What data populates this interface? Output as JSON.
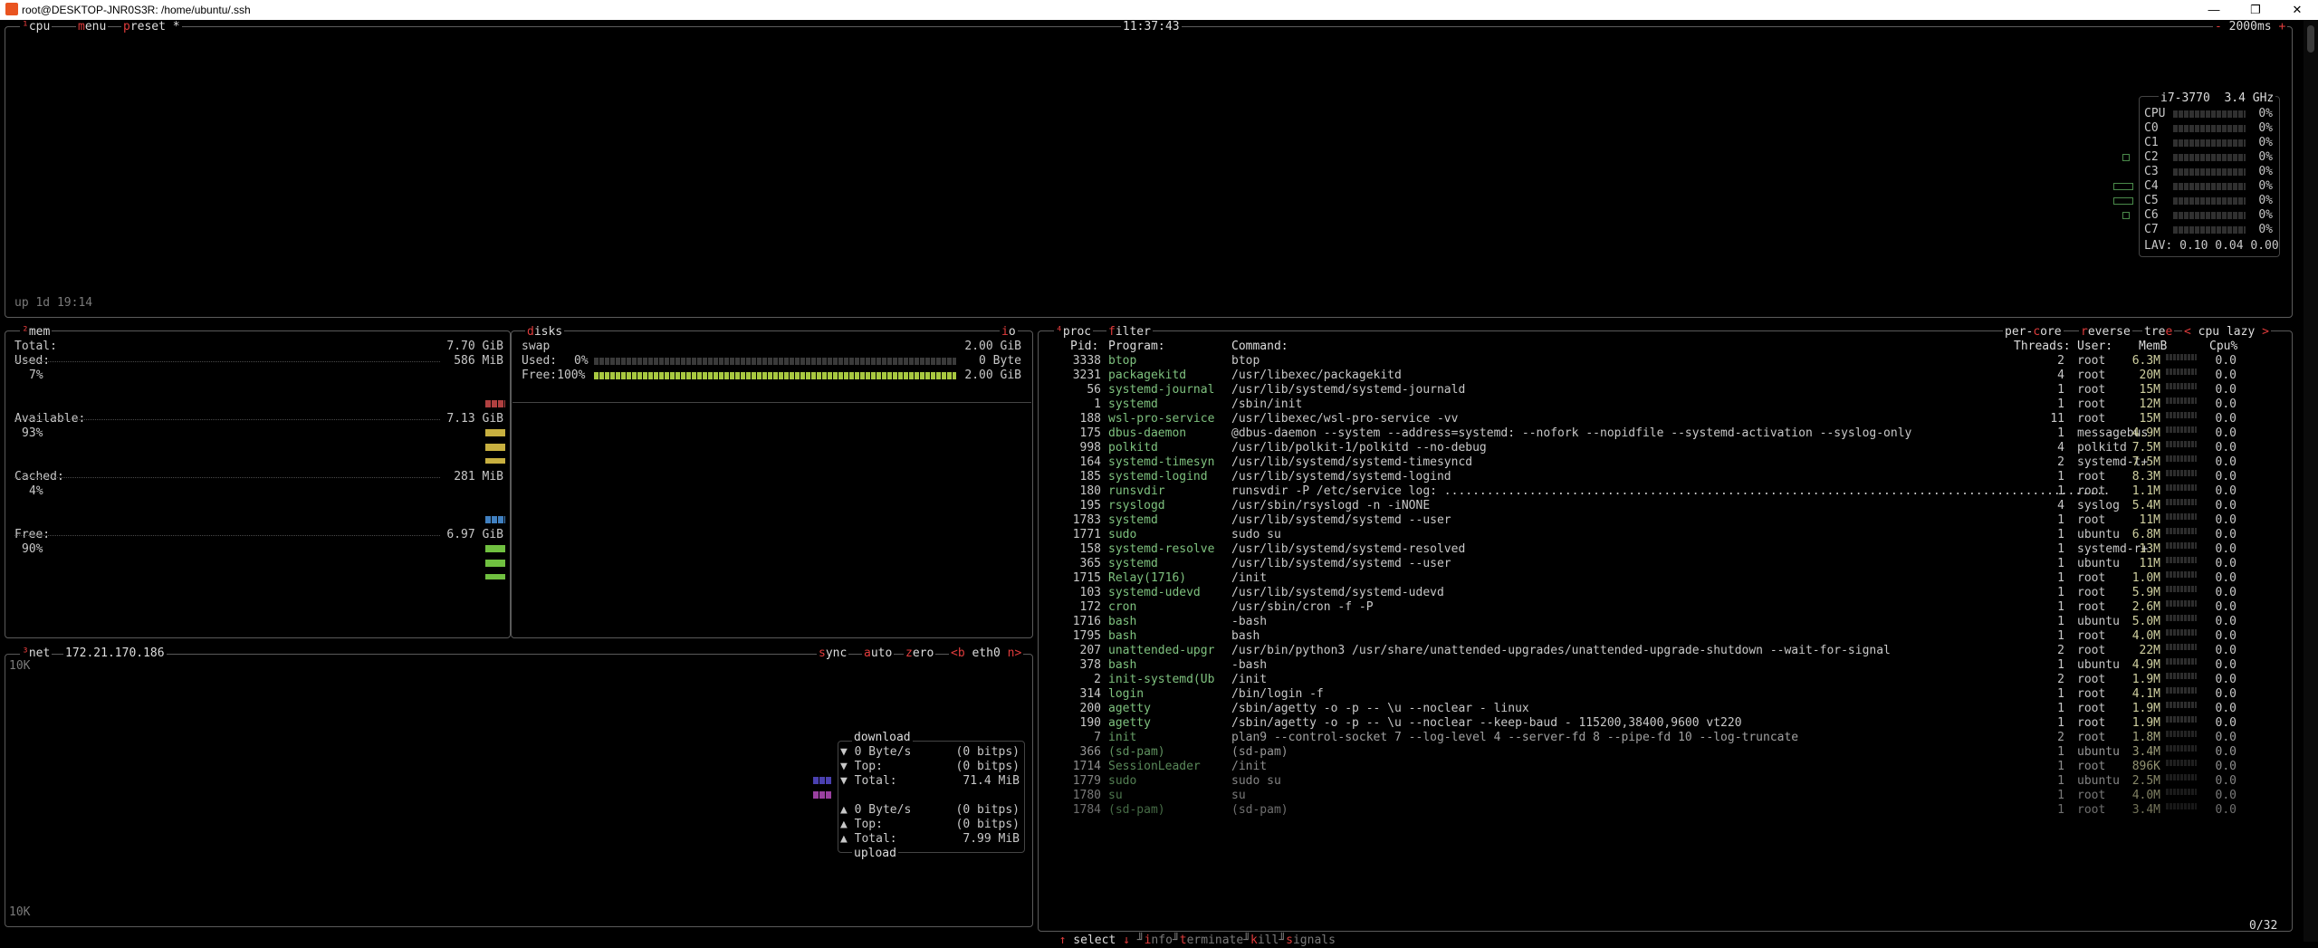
{
  "window": {
    "title": "root@DESKTOP-JNR0S3R: /home/ubuntu/.ssh",
    "minimize_glyph": "—",
    "restore_glyph": "❐",
    "close_glyph": "✕"
  },
  "cpu_box": {
    "tab_cpu": "¹cpu",
    "tab_menu": "menu",
    "tab_preset": "preset *",
    "clock": "11:37:43",
    "refresh": "2000ms",
    "uptime": "up 1d 19:14",
    "model": "i7-3770",
    "freq": "3.4 GHz",
    "cores": [
      {
        "name": "CPU",
        "pct": "0%"
      },
      {
        "name": "C0",
        "pct": "0%"
      },
      {
        "name": "C1",
        "pct": "0%"
      },
      {
        "name": "C2",
        "pct": "0%"
      },
      {
        "name": "C3",
        "pct": "0%"
      },
      {
        "name": "C4",
        "pct": "0%"
      },
      {
        "name": "C5",
        "pct": "0%"
      },
      {
        "name": "C6",
        "pct": "0%"
      },
      {
        "name": "C7",
        "pct": "0%"
      }
    ],
    "lav": "LAV: 0.10 0.04 0.00"
  },
  "mem_box": {
    "tab": "²mem",
    "total_label": "Total:",
    "total_value": "7.70 GiB",
    "used_label": "Used:",
    "used_value": "586 MiB",
    "used_pct": "7%",
    "avail_label": "Available:",
    "avail_value": "7.13 GiB",
    "avail_pct": "93%",
    "cached_label": "Cached:",
    "cached_value": "281 MiB",
    "cached_pct": "4%",
    "free_label": "Free:",
    "free_value": "6.97 GiB",
    "free_pct": "90%"
  },
  "disks_box": {
    "tab": "disks",
    "io_tab": "io",
    "swap_label": "swap",
    "swap_total": "2.00 GiB",
    "used_label": "Used:",
    "used_pct": "0%",
    "used_value": "0 Byte",
    "free_label": "Free:100%",
    "free_value": "2.00 GiB"
  },
  "net_box": {
    "tab": "³net",
    "ip": "172.21.170.186",
    "sync": "sync",
    "auto": "auto",
    "zero": "zero",
    "iface": "<b eth0 n>",
    "scale_top": "10K",
    "scale_bottom": "10K",
    "download_title": "download",
    "dl_rate": "▼ 0 Byte/s",
    "dl_rate_bits": "(0 bitps)",
    "dl_top": "▼ Top:",
    "dl_top_bits": "(0 bitps)",
    "dl_total": "▼ Total:",
    "dl_total_value": "71.4 MiB",
    "ul_rate": "▲ 0 Byte/s",
    "ul_rate_bits": "(0 bitps)",
    "ul_top": "▲ Top:",
    "ul_top_bits": "(0 bitps)",
    "ul_total": "▲ Total:",
    "ul_total_value": "7.99 MiB",
    "upload_title": "upload"
  },
  "proc_box": {
    "tab": "⁴proc",
    "filter": "filter",
    "per_core": "per-core",
    "reverse": "reverse",
    "tree": "tree",
    "sort": "< cpu lazy >",
    "headers": {
      "pid": "Pid:",
      "program": "Program:",
      "command": "Command:",
      "threads": "Threads:",
      "user": "User:",
      "mem": "MemB",
      "cpu": "Cpu%"
    },
    "rows": [
      {
        "pid": "3338",
        "prog": "btop",
        "cmd": "btop",
        "thr": "2",
        "user": "root",
        "mem": "6.3M",
        "cpu": "0.0"
      },
      {
        "pid": "3231",
        "prog": "packagekitd",
        "cmd": "/usr/libexec/packagekitd",
        "thr": "4",
        "user": "root",
        "mem": "20M",
        "cpu": "0.0"
      },
      {
        "pid": "56",
        "prog": "systemd-journal",
        "cmd": "/usr/lib/systemd/systemd-journald",
        "thr": "1",
        "user": "root",
        "mem": "15M",
        "cpu": "0.0"
      },
      {
        "pid": "1",
        "prog": "systemd",
        "cmd": "/sbin/init",
        "thr": "1",
        "user": "root",
        "mem": "12M",
        "cpu": "0.0"
      },
      {
        "pid": "188",
        "prog": "wsl-pro-service",
        "cmd": "/usr/libexec/wsl-pro-service -vv",
        "thr": "11",
        "user": "root",
        "mem": "15M",
        "cpu": "0.0"
      },
      {
        "pid": "175",
        "prog": "dbus-daemon",
        "cmd": "@dbus-daemon --system --address=systemd: --nofork --nopidfile --systemd-activation --syslog-only",
        "thr": "1",
        "user": "messagebus",
        "mem": "4.9M",
        "cpu": "0.0"
      },
      {
        "pid": "998",
        "prog": "polkitd",
        "cmd": "/usr/lib/polkit-1/polkitd --no-debug",
        "thr": "4",
        "user": "polkitd",
        "mem": "7.5M",
        "cpu": "0.0"
      },
      {
        "pid": "164",
        "prog": "systemd-timesyn",
        "cmd": "/usr/lib/systemd/systemd-timesyncd",
        "thr": "2",
        "user": "systemd-t+",
        "mem": "7.5M",
        "cpu": "0.0"
      },
      {
        "pid": "185",
        "prog": "systemd-logind",
        "cmd": "/usr/lib/systemd/systemd-logind",
        "thr": "1",
        "user": "root",
        "mem": "8.3M",
        "cpu": "0.0"
      },
      {
        "pid": "180",
        "prog": "runsvdir",
        "cmd": "runsvdir -P /etc/service log: ..............................................................................................",
        "thr": "1",
        "user": "root",
        "mem": "1.1M",
        "cpu": "0.0"
      },
      {
        "pid": "195",
        "prog": "rsyslogd",
        "cmd": "/usr/sbin/rsyslogd -n -iNONE",
        "thr": "4",
        "user": "syslog",
        "mem": "5.4M",
        "cpu": "0.0"
      },
      {
        "pid": "1783",
        "prog": "systemd",
        "cmd": "/usr/lib/systemd/systemd --user",
        "thr": "1",
        "user": "root",
        "mem": "11M",
        "cpu": "0.0"
      },
      {
        "pid": "1771",
        "prog": "sudo",
        "cmd": "sudo su",
        "thr": "1",
        "user": "ubuntu",
        "mem": "6.8M",
        "cpu": "0.0"
      },
      {
        "pid": "158",
        "prog": "systemd-resolve",
        "cmd": "/usr/lib/systemd/systemd-resolved",
        "thr": "1",
        "user": "systemd-r+",
        "mem": "13M",
        "cpu": "0.0"
      },
      {
        "pid": "365",
        "prog": "systemd",
        "cmd": "/usr/lib/systemd/systemd --user",
        "thr": "1",
        "user": "ubuntu",
        "mem": "11M",
        "cpu": "0.0"
      },
      {
        "pid": "1715",
        "prog": "Relay(1716)",
        "cmd": "/init",
        "thr": "1",
        "user": "root",
        "mem": "1.0M",
        "cpu": "0.0"
      },
      {
        "pid": "103",
        "prog": "systemd-udevd",
        "cmd": "/usr/lib/systemd/systemd-udevd",
        "thr": "1",
        "user": "root",
        "mem": "5.9M",
        "cpu": "0.0"
      },
      {
        "pid": "172",
        "prog": "cron",
        "cmd": "/usr/sbin/cron -f -P",
        "thr": "1",
        "user": "root",
        "mem": "2.6M",
        "cpu": "0.0"
      },
      {
        "pid": "1716",
        "prog": "bash",
        "cmd": "-bash",
        "thr": "1",
        "user": "ubuntu",
        "mem": "5.0M",
        "cpu": "0.0"
      },
      {
        "pid": "1795",
        "prog": "bash",
        "cmd": "bash",
        "thr": "1",
        "user": "root",
        "mem": "4.0M",
        "cpu": "0.0"
      },
      {
        "pid": "207",
        "prog": "unattended-upgr",
        "cmd": "/usr/bin/python3 /usr/share/unattended-upgrades/unattended-upgrade-shutdown --wait-for-signal",
        "thr": "2",
        "user": "root",
        "mem": "22M",
        "cpu": "0.0"
      },
      {
        "pid": "378",
        "prog": "bash",
        "cmd": "-bash",
        "thr": "1",
        "user": "ubuntu",
        "mem": "4.9M",
        "cpu": "0.0"
      },
      {
        "pid": "2",
        "prog": "init-systemd(Ub",
        "cmd": "/init",
        "thr": "2",
        "user": "root",
        "mem": "1.9M",
        "cpu": "0.0"
      },
      {
        "pid": "314",
        "prog": "login",
        "cmd": "/bin/login -f",
        "thr": "1",
        "user": "root",
        "mem": "4.1M",
        "cpu": "0.0"
      },
      {
        "pid": "200",
        "prog": "agetty",
        "cmd": "/sbin/agetty -o -p -- \\u --noclear - linux",
        "thr": "1",
        "user": "root",
        "mem": "1.9M",
        "cpu": "0.0"
      },
      {
        "pid": "190",
        "prog": "agetty",
        "cmd": "/sbin/agetty -o -p -- \\u --noclear --keep-baud - 115200,38400,9600 vt220",
        "thr": "1",
        "user": "root",
        "mem": "1.9M",
        "cpu": "0.0"
      },
      {
        "pid": "7",
        "prog": "init",
        "cmd": "plan9 --control-socket 7 --log-level 4 --server-fd 8 --pipe-fd 10 --log-truncate",
        "thr": "2",
        "user": "root",
        "mem": "1.8M",
        "cpu": "0.0"
      },
      {
        "pid": "366",
        "prog": "(sd-pam)",
        "cmd": "(sd-pam)",
        "thr": "1",
        "user": "ubuntu",
        "mem": "3.4M",
        "cpu": "0.0"
      },
      {
        "pid": "1714",
        "prog": "SessionLeader",
        "cmd": "/init",
        "thr": "1",
        "user": "root",
        "mem": "896K",
        "cpu": "0.0"
      },
      {
        "pid": "1779",
        "prog": "sudo",
        "cmd": "sudo su",
        "thr": "1",
        "user": "ubuntu",
        "mem": "2.5M",
        "cpu": "0.0"
      },
      {
        "pid": "1780",
        "prog": "su",
        "cmd": "su",
        "thr": "1",
        "user": "root",
        "mem": "4.0M",
        "cpu": "0.0"
      },
      {
        "pid": "1784",
        "prog": "(sd-pam)",
        "cmd": "(sd-pam)",
        "thr": "1",
        "user": "root",
        "mem": "3.4M",
        "cpu": "0.0"
      }
    ],
    "footer_select": "↑ select ↓",
    "footer_info": "info",
    "footer_terminate": "terminate",
    "footer_kill": "kill",
    "footer_signals": "signals",
    "footer_count": "0/32"
  }
}
